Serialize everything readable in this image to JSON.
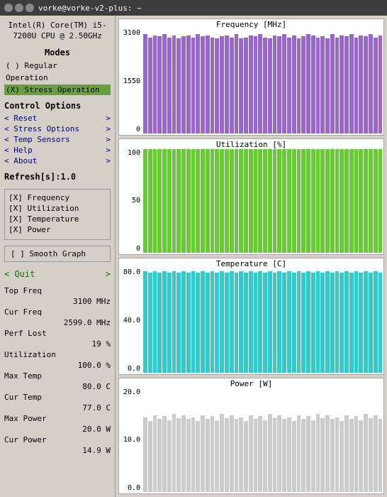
{
  "titleBar": {
    "title": "vorke@vorke-v2-plus: ~",
    "buttons": [
      "close",
      "minimize",
      "maximize"
    ]
  },
  "sidebar": {
    "cpuInfo": "Intel(R) Core(TM)\ni5-7200U CPU @\n2.50GHz",
    "modesTitle": "Modes",
    "modes": [
      {
        "label": "( ) Regular",
        "selected": false
      },
      {
        "label": "Operation",
        "selected": false
      },
      {
        "label": "(X) Stress Operation",
        "selected": true
      }
    ],
    "controlTitle": "Control Options",
    "controls": [
      {
        "left": "< Reset",
        "right": ">"
      },
      {
        "left": "< Stress Options",
        "right": ">"
      },
      {
        "left": "< Temp Sensors",
        "right": ">"
      },
      {
        "left": "< Help",
        "right": ">"
      },
      {
        "left": "< About",
        "right": ">"
      }
    ],
    "refresh": "Refresh[s]:1.0",
    "checkboxes": [
      "[X] Frequency",
      "[X] Utilization",
      "[X] Temperature",
      "[X] Power"
    ],
    "smoothGraph": "[ ] Smooth Graph",
    "quit": {
      "left": "< Quit",
      "right": ">"
    },
    "stats": [
      {
        "label": "Top Freq",
        "value": ""
      },
      {
        "label": "",
        "value": "3100 MHz"
      },
      {
        "label": "Cur Freq",
        "value": ""
      },
      {
        "label": "",
        "value": "2599.0 MHz"
      },
      {
        "label": "Perf Lost",
        "value": ""
      },
      {
        "label": "",
        "value": "19 %"
      },
      {
        "label": "Utilization",
        "value": ""
      },
      {
        "label": "",
        "value": "100.0 %"
      },
      {
        "label": "Max Temp",
        "value": ""
      },
      {
        "label": "",
        "value": "80.0 C"
      },
      {
        "label": "Cur Temp",
        "value": ""
      },
      {
        "label": "",
        "value": "77.0 C"
      },
      {
        "label": "Max Power",
        "value": ""
      },
      {
        "label": "",
        "value": "20.0 W"
      },
      {
        "label": "Cur Power",
        "value": ""
      },
      {
        "label": "",
        "value": "14.9 W"
      }
    ]
  },
  "charts": {
    "frequency": {
      "title": "Frequency [MHz]",
      "yLabels": [
        "3100",
        "1550",
        "0"
      ],
      "bars": [
        95,
        92,
        94,
        93,
        95,
        92,
        94,
        91,
        93,
        94,
        92,
        95,
        93,
        94,
        92,
        91,
        93,
        94,
        92,
        95,
        91,
        92,
        94,
        93,
        95,
        92,
        91,
        94,
        93,
        95,
        92,
        94,
        91,
        93,
        95,
        94,
        92,
        93,
        91,
        95,
        92,
        94,
        93,
        95,
        92,
        94,
        93,
        95,
        92,
        94
      ]
    },
    "utilization": {
      "title": "Utilization [%]",
      "yLabels": [
        "100",
        "50",
        "0"
      ],
      "bars": [
        100,
        100,
        100,
        100,
        100,
        100,
        100,
        100,
        100,
        100,
        100,
        100,
        100,
        100,
        100,
        100,
        100,
        100,
        100,
        100,
        100,
        100,
        100,
        100,
        100,
        100,
        100,
        100,
        100,
        100,
        100,
        100,
        100,
        100,
        100,
        100,
        100,
        100,
        100,
        100,
        100,
        100,
        100,
        100,
        100,
        100,
        100,
        100,
        100,
        100
      ]
    },
    "temperature": {
      "title": "Temperature [C]",
      "yLabels": [
        "80.0",
        "40.0",
        "0.0"
      ],
      "bars": [
        97,
        96,
        97,
        96,
        97,
        96,
        97,
        96,
        97,
        96,
        97,
        96,
        97,
        96,
        97,
        96,
        97,
        96,
        97,
        96,
        97,
        96,
        97,
        96,
        97,
        96,
        97,
        96,
        97,
        96,
        97,
        96,
        97,
        96,
        97,
        96,
        97,
        96,
        97,
        96,
        97,
        96,
        97,
        96,
        97,
        96,
        97,
        96,
        97,
        96
      ]
    },
    "power": {
      "title": "Power [W]",
      "yLabels": [
        "20.0",
        "10.0",
        "0.0"
      ],
      "bars": [
        72,
        68,
        74,
        70,
        73,
        69,
        75,
        71,
        74,
        70,
        72,
        68,
        74,
        70,
        73,
        69,
        75,
        71,
        74,
        70,
        72,
        68,
        74,
        70,
        73,
        69,
        75,
        71,
        74,
        70,
        72,
        68,
        74,
        70,
        73,
        69,
        75,
        71,
        74,
        70,
        72,
        68,
        74,
        70,
        73,
        69,
        75,
        71,
        74,
        70
      ]
    }
  }
}
